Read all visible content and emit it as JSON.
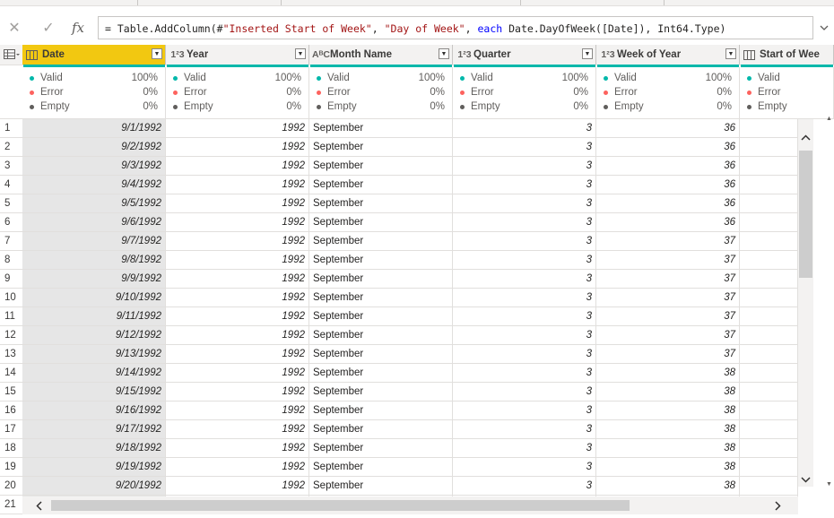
{
  "formula_bar": {
    "cancel_icon": "close-icon",
    "confirm_icon": "check-icon",
    "fx_label": "fx",
    "formula_prefix": "= Table.AddColumn(#",
    "formula_str1": "\"Inserted Start of Week\"",
    "formula_mid1": ", ",
    "formula_str2": "\"Day of Week\"",
    "formula_mid2": ", ",
    "formula_kw": "each",
    "formula_suffix": " Date.DayOfWeek([Date]), Int64.Type)"
  },
  "columns": [
    {
      "name": "Date",
      "type_icon": "calendar-icon",
      "selected": true
    },
    {
      "name": "Year",
      "type_icon": "1²3"
    },
    {
      "name": "Month Name",
      "type_icon": "AᴮC"
    },
    {
      "name": "Quarter",
      "type_icon": "1²3"
    },
    {
      "name": "Week of Year",
      "type_icon": "1²3"
    },
    {
      "name": "Start of Wee",
      "type_icon": "calendar-icon"
    }
  ],
  "quality": {
    "labels": [
      "Valid",
      "Error",
      "Empty"
    ],
    "colors": {
      "valid": "#01b8aa",
      "error": "#fd625e",
      "empty": "#605e5c"
    },
    "percents": [
      "100%",
      "0%",
      "0%"
    ]
  },
  "rows": [
    {
      "n": "1",
      "date": "9/1/1992",
      "year": "1992",
      "month": "September",
      "quarter": "3",
      "week": "36"
    },
    {
      "n": "2",
      "date": "9/2/1992",
      "year": "1992",
      "month": "September",
      "quarter": "3",
      "week": "36"
    },
    {
      "n": "3",
      "date": "9/3/1992",
      "year": "1992",
      "month": "September",
      "quarter": "3",
      "week": "36"
    },
    {
      "n": "4",
      "date": "9/4/1992",
      "year": "1992",
      "month": "September",
      "quarter": "3",
      "week": "36"
    },
    {
      "n": "5",
      "date": "9/5/1992",
      "year": "1992",
      "month": "September",
      "quarter": "3",
      "week": "36"
    },
    {
      "n": "6",
      "date": "9/6/1992",
      "year": "1992",
      "month": "September",
      "quarter": "3",
      "week": "36"
    },
    {
      "n": "7",
      "date": "9/7/1992",
      "year": "1992",
      "month": "September",
      "quarter": "3",
      "week": "37"
    },
    {
      "n": "8",
      "date": "9/8/1992",
      "year": "1992",
      "month": "September",
      "quarter": "3",
      "week": "37"
    },
    {
      "n": "9",
      "date": "9/9/1992",
      "year": "1992",
      "month": "September",
      "quarter": "3",
      "week": "37"
    },
    {
      "n": "10",
      "date": "9/10/1992",
      "year": "1992",
      "month": "September",
      "quarter": "3",
      "week": "37"
    },
    {
      "n": "11",
      "date": "9/11/1992",
      "year": "1992",
      "month": "September",
      "quarter": "3",
      "week": "37"
    },
    {
      "n": "12",
      "date": "9/12/1992",
      "year": "1992",
      "month": "September",
      "quarter": "3",
      "week": "37"
    },
    {
      "n": "13",
      "date": "9/13/1992",
      "year": "1992",
      "month": "September",
      "quarter": "3",
      "week": "37"
    },
    {
      "n": "14",
      "date": "9/14/1992",
      "year": "1992",
      "month": "September",
      "quarter": "3",
      "week": "38"
    },
    {
      "n": "15",
      "date": "9/15/1992",
      "year": "1992",
      "month": "September",
      "quarter": "3",
      "week": "38"
    },
    {
      "n": "16",
      "date": "9/16/1992",
      "year": "1992",
      "month": "September",
      "quarter": "3",
      "week": "38"
    },
    {
      "n": "17",
      "date": "9/17/1992",
      "year": "1992",
      "month": "September",
      "quarter": "3",
      "week": "38"
    },
    {
      "n": "18",
      "date": "9/18/1992",
      "year": "1992",
      "month": "September",
      "quarter": "3",
      "week": "38"
    },
    {
      "n": "19",
      "date": "9/19/1992",
      "year": "1992",
      "month": "September",
      "quarter": "3",
      "week": "38"
    },
    {
      "n": "20",
      "date": "9/20/1992",
      "year": "1992",
      "month": "September",
      "quarter": "3",
      "week": "38"
    },
    {
      "n": "21",
      "date": "",
      "year": "",
      "month": "",
      "quarter": "",
      "week": ""
    }
  ],
  "colors": {
    "selected_header": "#f2c811",
    "quality_bar": "#01b8aa",
    "selected_column": "#e6e6e6"
  }
}
